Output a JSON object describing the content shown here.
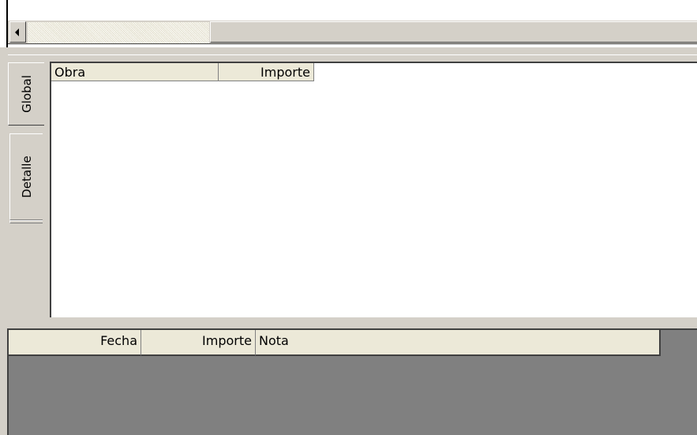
{
  "tabs": [
    {
      "label": "Global",
      "active": true
    },
    {
      "label": "Detalle",
      "active": false
    }
  ],
  "upper_table": {
    "columns": [
      "Obra",
      "Importe"
    ],
    "rows": []
  },
  "lower_table": {
    "columns": [
      "Fecha",
      "Importe",
      "Nota"
    ],
    "rows": []
  },
  "colors": {
    "face": "#d4d0c8",
    "header": "#ece9d8",
    "grid_empty": "#808080",
    "list_background": "#ffffff"
  }
}
